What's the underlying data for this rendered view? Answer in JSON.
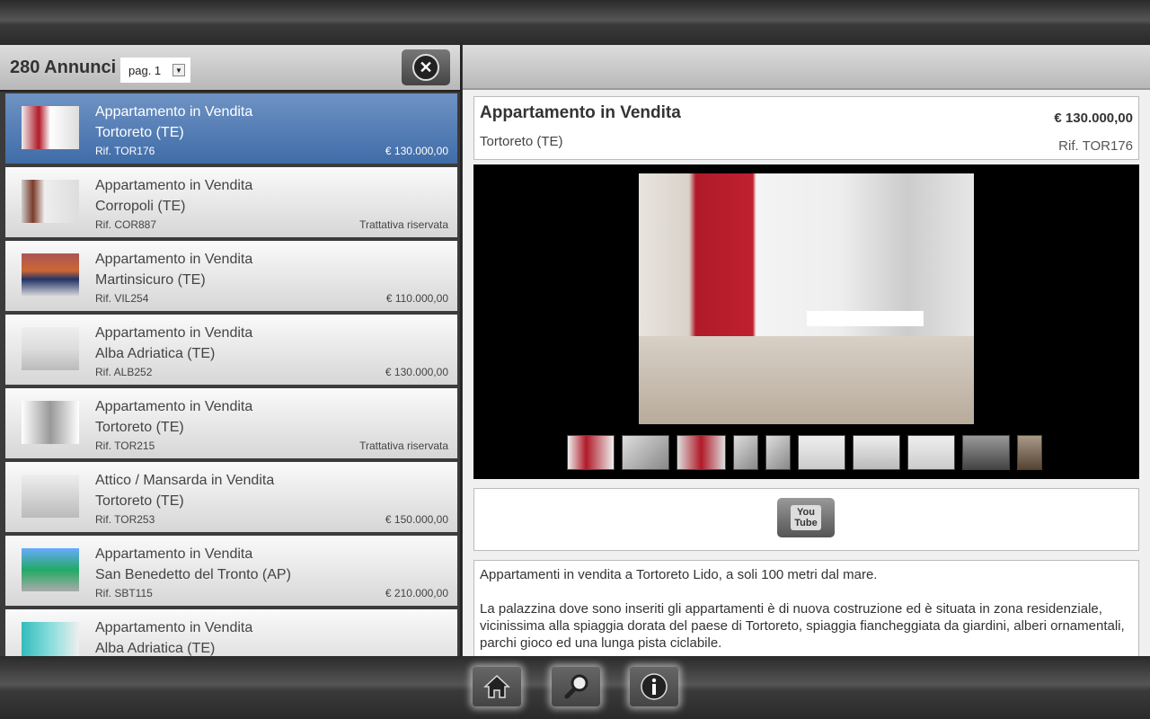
{
  "list": {
    "count": "280 Annunci",
    "page": "pag. 1",
    "items": [
      {
        "title": "Appartamento in Vendita",
        "location": "Tortoreto (TE)",
        "ref": "Rif. TOR176",
        "price": "€ 130.000,00",
        "selected": true
      },
      {
        "title": "Appartamento in Vendita",
        "location": "Corropoli (TE)",
        "ref": "Rif. COR887",
        "price": "Trattativa riservata"
      },
      {
        "title": "Appartamento in Vendita",
        "location": "Martinsicuro (TE)",
        "ref": "Rif. VIL254",
        "price": "€ 110.000,00"
      },
      {
        "title": "Appartamento in Vendita",
        "location": "Alba Adriatica (TE)",
        "ref": "Rif. ALB252",
        "price": "€ 130.000,00"
      },
      {
        "title": "Appartamento in Vendita",
        "location": "Tortoreto (TE)",
        "ref": "Rif. TOR215",
        "price": "Trattativa riservata"
      },
      {
        "title": "Attico / Mansarda in Vendita",
        "location": "Tortoreto (TE)",
        "ref": "Rif. TOR253",
        "price": "€ 150.000,00"
      },
      {
        "title": "Appartamento in Vendita",
        "location": "San Benedetto del Tronto (AP)",
        "ref": "Rif. SBT115",
        "price": "€ 210.000,00"
      },
      {
        "title": "Appartamento in Vendita",
        "location": "Alba Adriatica (TE)",
        "ref": "",
        "price": ""
      }
    ]
  },
  "detail": {
    "title": "Appartamento in Vendita",
    "location": "Tortoreto (TE)",
    "price": "€ 130.000,00",
    "ref": "Rif. TOR176",
    "youtube_label": "You Tube",
    "description": [
      "Appartamenti in vendita a Tortoreto Lido, a soli 100 metri dal mare.",
      "La palazzina dove sono inseriti gli appartamenti è di nuova costruzione ed è situata in zona residenziale, vicinissima alla spiaggia dorata del paese di Tortoreto, spiaggia fiancheggiata da giardini, alberi ornamentali, parchi gioco ed una lunga pista ciclabile."
    ]
  },
  "nav": {
    "icons": [
      "home-icon",
      "search-icon",
      "info-icon"
    ]
  },
  "colors": {
    "selected": "#4f79b3"
  }
}
